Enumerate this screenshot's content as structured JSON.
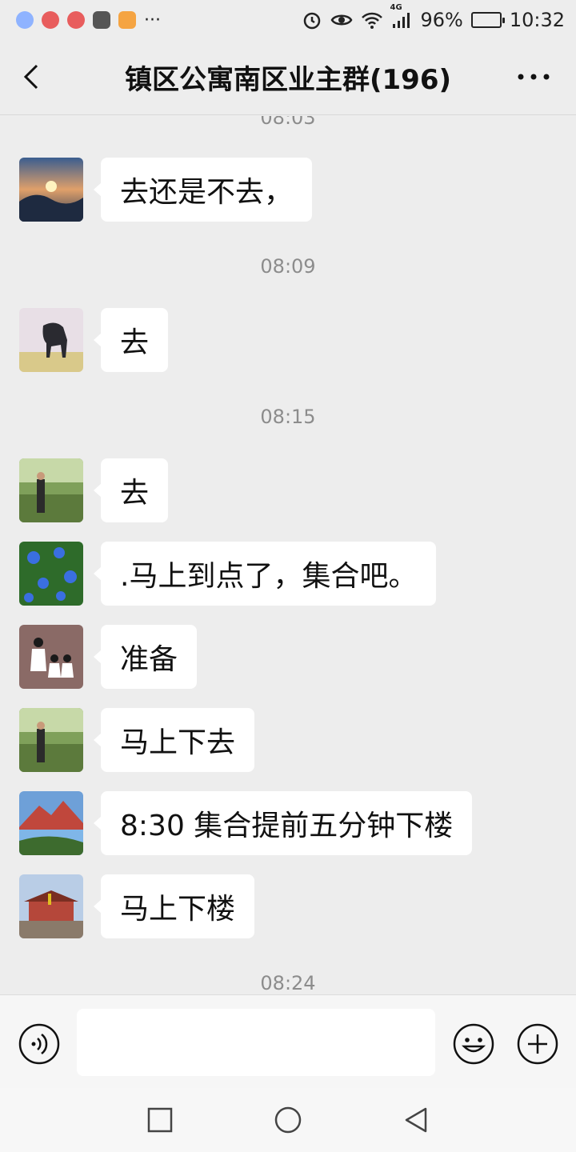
{
  "status_bar": {
    "network": "4G",
    "battery": "96%",
    "battery_level": 0.96,
    "time": "10:32",
    "more_indicator": "···"
  },
  "header": {
    "title": "镇区公寓南区业主群(196)"
  },
  "timestamps": {
    "partial_top": "08:03",
    "t1": "08:09",
    "t2": "08:15",
    "t3": "08:24"
  },
  "messages": [
    {
      "avatar": "sunset-avatar",
      "text": "去还是不去，"
    },
    {
      "avatar": "horse-avatar",
      "text": "去"
    },
    {
      "avatar": "man-in-park-avatar",
      "text": "去"
    },
    {
      "avatar": "blue-flowers-avatar",
      "text": ".马上到点了，集合吧。"
    },
    {
      "avatar": "girls-silhouette-avatar",
      "text": "准备"
    },
    {
      "avatar": "man-in-park-avatar",
      "text": "马上下去"
    },
    {
      "avatar": "mountain-lake-avatar",
      "text": "8:30 集合提前五分钟下楼"
    },
    {
      "avatar": "temple-avatar",
      "text": "马上下楼"
    }
  ],
  "input": {
    "value": "",
    "placeholder": ""
  },
  "colors": {
    "background": "#ededed",
    "bubble": "#ffffff",
    "timestamp": "#8c8c8c"
  }
}
